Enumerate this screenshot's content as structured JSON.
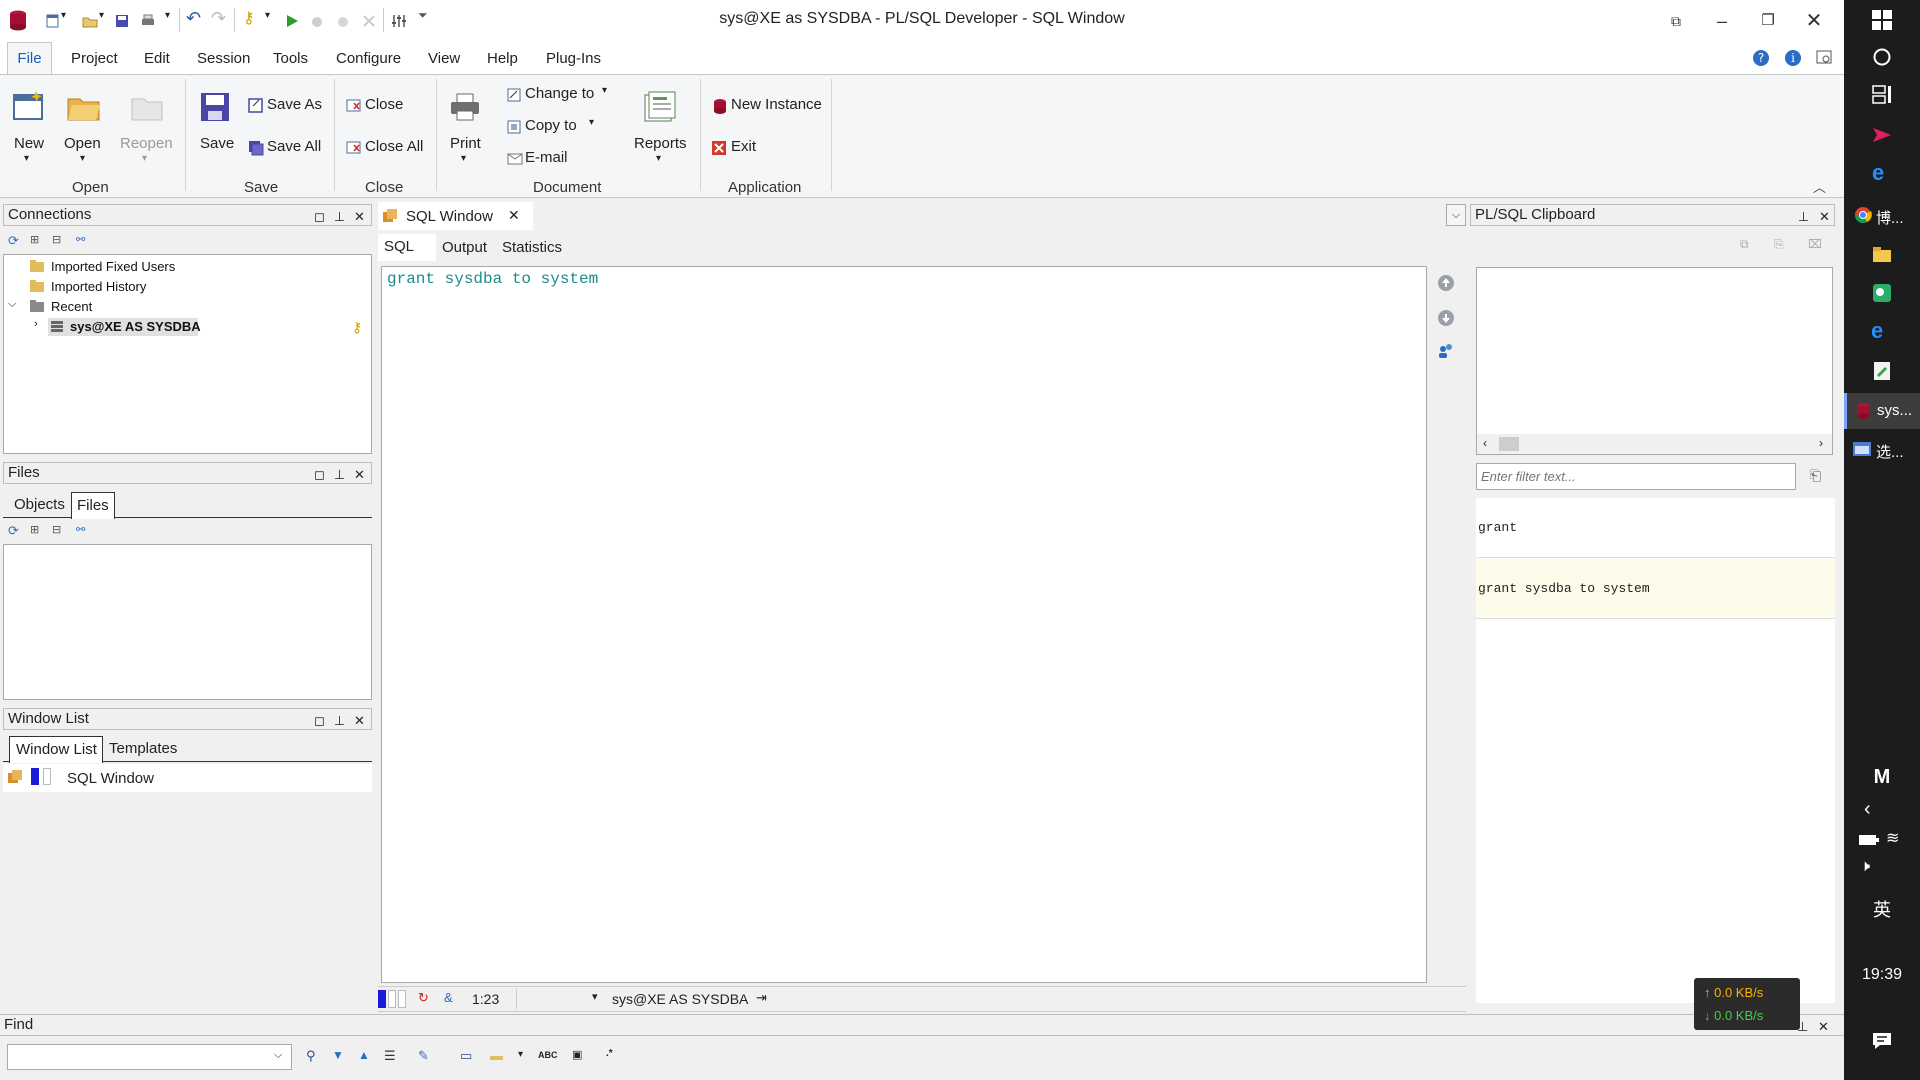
{
  "window": {
    "title": "sys@XE as SYSDBA - PL/SQL Developer - SQL Window"
  },
  "menu": {
    "items": [
      "File",
      "Project",
      "Edit",
      "Session",
      "Tools",
      "Configure",
      "View",
      "Help",
      "Plug-Ins"
    ]
  },
  "ribbon": {
    "open_group": {
      "label": "Open",
      "new": "New",
      "open": "Open",
      "reopen": "Reopen"
    },
    "save_group": {
      "label": "Save",
      "save": "Save",
      "save_as": "Save As",
      "save_all": "Save All"
    },
    "close_group": {
      "label": "Close",
      "close": "Close",
      "close_all": "Close All"
    },
    "document_group": {
      "label": "Document",
      "print": "Print",
      "change_to": "Change to",
      "copy_to": "Copy to",
      "email": "E-mail",
      "reports": "Reports"
    },
    "application_group": {
      "label": "Application",
      "new_instance": "New Instance",
      "exit": "Exit"
    }
  },
  "connections": {
    "title": "Connections",
    "items": [
      "Imported Fixed Users",
      "Imported History",
      "Recent",
      "sys@XE AS SYSDBA"
    ]
  },
  "files": {
    "title": "Files",
    "tabs": [
      "Objects",
      "Files"
    ]
  },
  "window_list": {
    "title": "Window List",
    "tabs": [
      "Window List",
      "Templates"
    ],
    "items": [
      "SQL Window"
    ]
  },
  "document_tab": {
    "label": "SQL Window"
  },
  "sql_tabs": [
    "SQL",
    "Output",
    "Statistics"
  ],
  "editor": {
    "text": "grant sysdba to system"
  },
  "status": {
    "position": "1:23",
    "connection": "sys@XE AS SYSDBA"
  },
  "clipboard": {
    "title": "PL/SQL Clipboard",
    "filter_placeholder": "Enter filter text...",
    "items": [
      "grant",
      "grant sysdba to system"
    ]
  },
  "find": {
    "title": "Find",
    "input_value": ""
  },
  "netspeed": {
    "up": "↑ 0.0 KB/s",
    "down": "↓ 0.0 KB/s"
  },
  "taskbar": {
    "items": [
      "博...",
      "sys...",
      "选..."
    ],
    "ime_m": "M",
    "ime": "英",
    "clock": "19:39"
  },
  "colors": {
    "accent": "#1e5fb4",
    "sql_text": "#1a8c8c",
    "clip_highlight": "#fdfbe9",
    "net_up": "#ffb000",
    "net_down": "#44d044"
  }
}
